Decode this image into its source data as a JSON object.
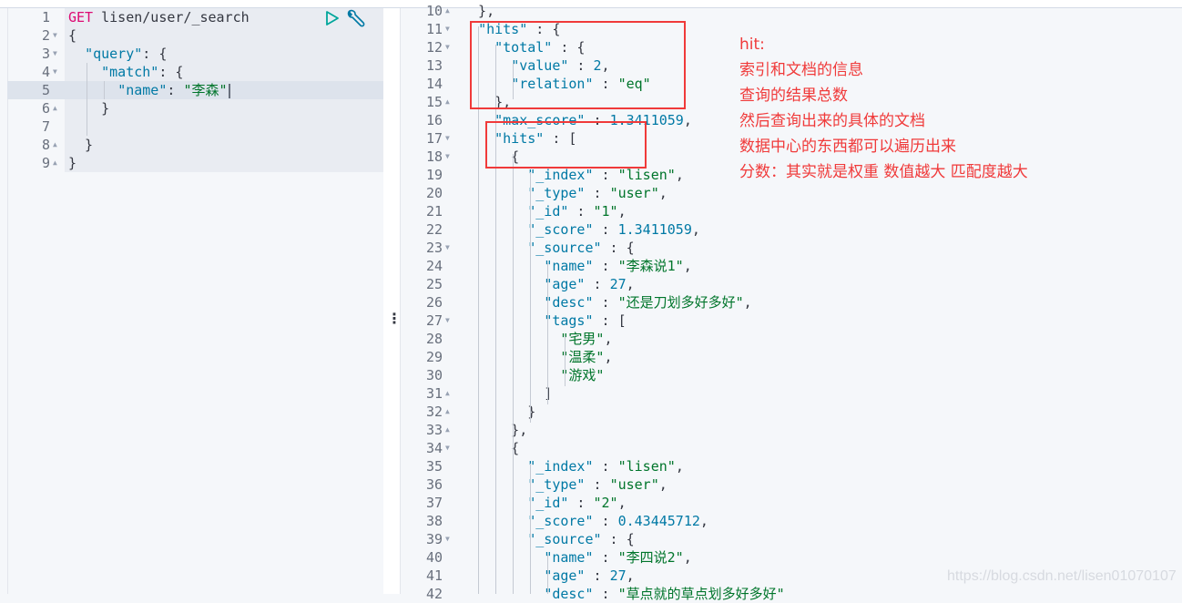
{
  "left_editor": {
    "run_icon": "play-icon",
    "settings_icon": "wrench-icon",
    "lines": [
      {
        "num": "1",
        "fold": "",
        "method": "GET",
        "text": " lisen/user/_search"
      },
      {
        "num": "2",
        "fold": "▼",
        "text": "{"
      },
      {
        "num": "3",
        "fold": "▼",
        "key": "\"query\"",
        "rest": ": {",
        "indent": "  "
      },
      {
        "num": "4",
        "fold": "▼",
        "key": "\"match\"",
        "rest": ": {",
        "indent": "    "
      },
      {
        "num": "5",
        "fold": "",
        "key": "\"name\"",
        "rest": ": ",
        "str": "\"李森\"",
        "indent": "      "
      },
      {
        "num": "6",
        "fold": "▲",
        "text": "    }"
      },
      {
        "num": "7",
        "fold": "",
        "text": ""
      },
      {
        "num": "8",
        "fold": "▲",
        "text": "  }"
      },
      {
        "num": "9",
        "fold": "▲",
        "text": "}"
      }
    ]
  },
  "right_editor": {
    "lines": [
      {
        "num": "10",
        "fold": "▲",
        "text": "  },"
      },
      {
        "num": "11",
        "fold": "▼",
        "indent": "  ",
        "key": "\"hits\"",
        "rest": " : {"
      },
      {
        "num": "12",
        "fold": "▼",
        "indent": "    ",
        "key": "\"total\"",
        "rest": " : {"
      },
      {
        "num": "13",
        "fold": "",
        "indent": "      ",
        "key": "\"value\"",
        "rest": " : ",
        "num_val": "2",
        "tail": ","
      },
      {
        "num": "14",
        "fold": "",
        "indent": "      ",
        "key": "\"relation\"",
        "rest": " : ",
        "str": "\"eq\""
      },
      {
        "num": "15",
        "fold": "▲",
        "text": "    },"
      },
      {
        "num": "16",
        "fold": "",
        "indent": "    ",
        "key": "\"max_score\"",
        "rest": " : ",
        "num_val": "1.3411059",
        "tail": ","
      },
      {
        "num": "17",
        "fold": "▼",
        "indent": "    ",
        "key": "\"hits\"",
        "rest": " : ["
      },
      {
        "num": "18",
        "fold": "▼",
        "text": "      {"
      },
      {
        "num": "19",
        "fold": "",
        "indent": "        ",
        "key": "\"_index\"",
        "rest": " : ",
        "str": "\"lisen\"",
        "tail": ","
      },
      {
        "num": "20",
        "fold": "",
        "indent": "        ",
        "key": "\"_type\"",
        "rest": " : ",
        "str": "\"user\"",
        "tail": ","
      },
      {
        "num": "21",
        "fold": "",
        "indent": "        ",
        "key": "\"_id\"",
        "rest": " : ",
        "str": "\"1\"",
        "tail": ","
      },
      {
        "num": "22",
        "fold": "",
        "indent": "        ",
        "key": "\"_score\"",
        "rest": " : ",
        "num_val": "1.3411059",
        "tail": ","
      },
      {
        "num": "23",
        "fold": "▼",
        "indent": "        ",
        "key": "\"_source\"",
        "rest": " : {"
      },
      {
        "num": "24",
        "fold": "",
        "indent": "          ",
        "key": "\"name\"",
        "rest": " : ",
        "str": "\"李森说1\"",
        "tail": ","
      },
      {
        "num": "25",
        "fold": "",
        "indent": "          ",
        "key": "\"age\"",
        "rest": " : ",
        "num_val": "27",
        "tail": ","
      },
      {
        "num": "26",
        "fold": "",
        "indent": "          ",
        "key": "\"desc\"",
        "rest": " : ",
        "str": "\"还是刀划多好多好\"",
        "tail": ","
      },
      {
        "num": "27",
        "fold": "▼",
        "indent": "          ",
        "key": "\"tags\"",
        "rest": " : ["
      },
      {
        "num": "28",
        "fold": "",
        "indent": "            ",
        "str": "\"宅男\"",
        "tail": ","
      },
      {
        "num": "29",
        "fold": "",
        "indent": "            ",
        "str": "\"温柔\"",
        "tail": ","
      },
      {
        "num": "30",
        "fold": "",
        "indent": "            ",
        "str": "\"游戏\""
      },
      {
        "num": "31",
        "fold": "▲",
        "text": "          ]"
      },
      {
        "num": "32",
        "fold": "▲",
        "text": "        }"
      },
      {
        "num": "33",
        "fold": "▲",
        "text": "      },"
      },
      {
        "num": "34",
        "fold": "▼",
        "text": "      {"
      },
      {
        "num": "35",
        "fold": "",
        "indent": "        ",
        "key": "\"_index\"",
        "rest": " : ",
        "str": "\"lisen\"",
        "tail": ","
      },
      {
        "num": "36",
        "fold": "",
        "indent": "        ",
        "key": "\"_type\"",
        "rest": " : ",
        "str": "\"user\"",
        "tail": ","
      },
      {
        "num": "37",
        "fold": "",
        "indent": "        ",
        "key": "\"_id\"",
        "rest": " : ",
        "str": "\"2\"",
        "tail": ","
      },
      {
        "num": "38",
        "fold": "",
        "indent": "        ",
        "key": "\"_score\"",
        "rest": " : ",
        "num_val": "0.43445712",
        "tail": ","
      },
      {
        "num": "39",
        "fold": "▼",
        "indent": "        ",
        "key": "\"_source\"",
        "rest": " : {"
      },
      {
        "num": "40",
        "fold": "",
        "indent": "          ",
        "key": "\"name\"",
        "rest": " : ",
        "str": "\"李四说2\"",
        "tail": ","
      },
      {
        "num": "41",
        "fold": "",
        "indent": "          ",
        "key": "\"age\"",
        "rest": " : ",
        "num_val": "27",
        "tail": ","
      },
      {
        "num": "42",
        "fold": "",
        "indent": "          ",
        "key": "\"desc\"",
        "rest": " : ",
        "str": "\"草点就的草点划多好多好\""
      }
    ]
  },
  "annotation": {
    "title": "hit:",
    "notes": [
      "索引和文档的信息",
      "查询的结果总数",
      "然后查询出来的具体的文档",
      "数据中心的东西都可以遍历出来",
      "分数：其实就是权重 数值越大 匹配度越大"
    ],
    "color": "#f03a3a"
  },
  "divider_handle": "⋮",
  "watermark": "https://blog.csdn.net/lisen01070107"
}
